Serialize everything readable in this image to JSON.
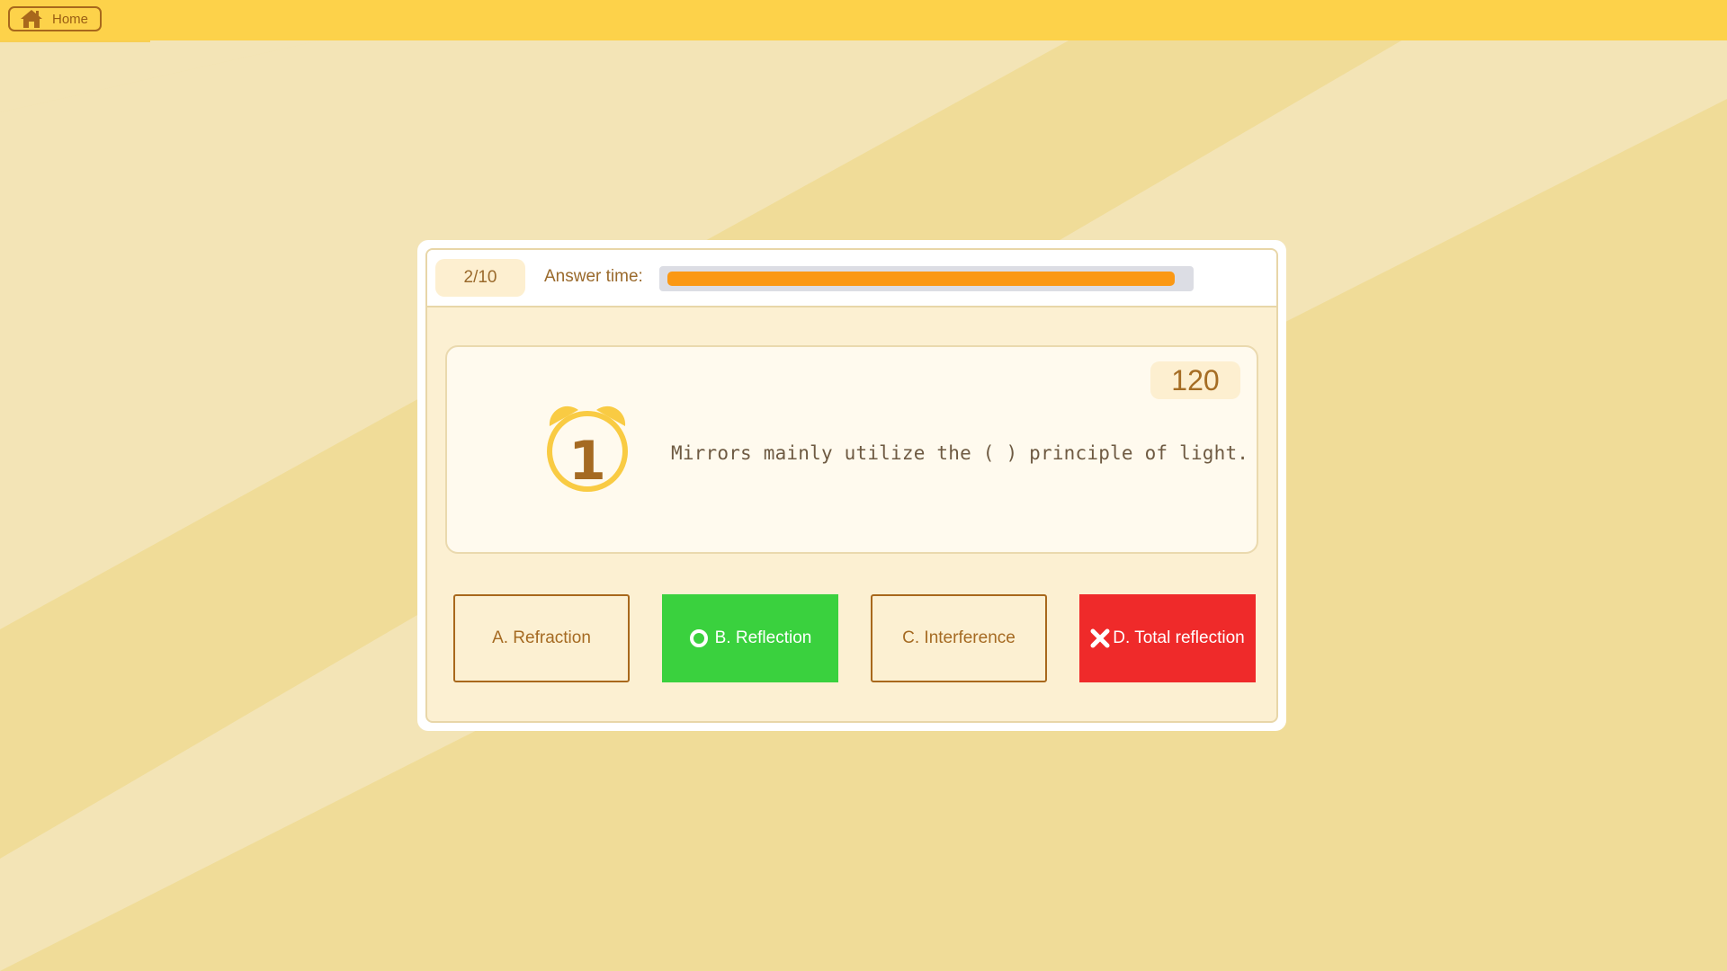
{
  "nav": {
    "home_label": "Home",
    "home_icon": "house-icon"
  },
  "quiz": {
    "progress": "2/10",
    "timer_label": "Answer time:",
    "time_remaining_fraction": 0.98,
    "timer_color": "#fb9814",
    "score": "120",
    "question_number": "1",
    "question_text": "Mirrors mainly utilize the ( ) principle of light."
  },
  "options": [
    {
      "label": "A. Refraction",
      "state": "neutral",
      "icon": ""
    },
    {
      "label": "B. Reflection",
      "state": "correct",
      "icon": "ring-icon",
      "color": "#3ad13e"
    },
    {
      "label": "C. Interference",
      "state": "neutral",
      "icon": ""
    },
    {
      "label": "D. Total reflection",
      "state": "wrong",
      "icon": "cross-icon",
      "color": "#ef2a2a"
    }
  ],
  "colors": {
    "topbar": "#fdd24a",
    "background": "#f0dc98",
    "accent_brown": "#a8681c"
  }
}
